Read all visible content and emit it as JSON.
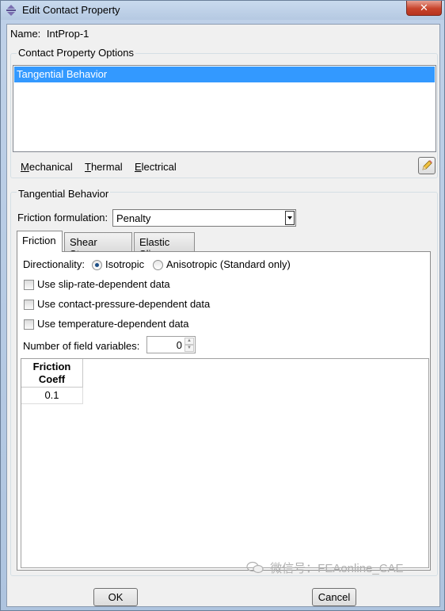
{
  "window": {
    "title": "Edit Contact Property",
    "close_label": "✕"
  },
  "name": {
    "label": "Name:",
    "value": "IntProp-1"
  },
  "options_group": {
    "title": "Contact Property Options",
    "items": [
      "Tangential Behavior"
    ]
  },
  "menu": {
    "mechanical": "Mechanical",
    "thermal": "Thermal",
    "electrical": "Electrical"
  },
  "behavior_group": {
    "title": "Tangential Behavior",
    "friction_formulation_label": "Friction formulation:",
    "friction_formulation_value": "Penalty"
  },
  "tabs": [
    "Friction",
    "Shear Stress",
    "Elastic Slip"
  ],
  "friction": {
    "directionality_label": "Directionality:",
    "isotropic": "Isotropic",
    "anisotropic": "Anisotropic (Standard only)",
    "selected": "Isotropic",
    "checkboxes": [
      "Use slip-rate-dependent data",
      "Use contact-pressure-dependent data",
      "Use temperature-dependent data"
    ],
    "field_vars_label": "Number of field variables:",
    "field_vars_value": "0"
  },
  "table": {
    "header_line1": "Friction",
    "header_line2": "Coeff",
    "rows": [
      "0.1"
    ]
  },
  "buttons": {
    "ok": "OK",
    "cancel": "Cancel"
  },
  "watermark": "微信号：FEAonline_CAE",
  "colors": {
    "selection": "#3399ff",
    "title_bg": "#bfd1e8",
    "close": "#c7432b"
  }
}
